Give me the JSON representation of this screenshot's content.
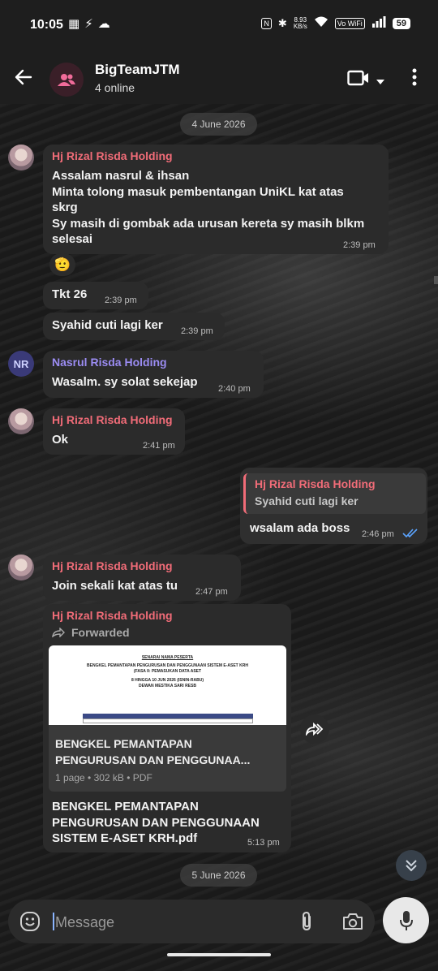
{
  "status_bar": {
    "time": "10:05",
    "net_speed": "8.93",
    "net_unit": "KB/s",
    "vowifi": "Vo WiFi",
    "battery": "59"
  },
  "header": {
    "title": "BigTeamJTM",
    "subtitle": "4 online"
  },
  "messages": {
    "date1": "4 June 2026",
    "m1_sender": "Hj Rizal Risda Holding",
    "m1_line1": "Assalam nasrul & ihsan",
    "m1_line2": "Minta tolong masuk pembentangan UniKL kat atas",
    "m1_line3": "skrg",
    "m1_line4": "Sy masih di gombak ada urusan kereta sy masih blkm",
    "m1_line5": "selesai",
    "m1_time": "2:39 pm",
    "reaction": "🫡",
    "m2_text": "Tkt 26",
    "m2_time": "2:39 pm",
    "m3_text": "Syahid cuti lagi ker",
    "m3_time": "2:39 pm",
    "m4_avatar": "NR",
    "m4_sender": "Nasrul Risda Holding",
    "m4_text": "Wasalm. sy solat sekejap",
    "m4_time": "2:40 pm",
    "m5_sender": "Hj Rizal Risda Holding",
    "m5_text": "Ok",
    "m5_time": "2:41 pm",
    "m6_reply_sender": "Hj Rizal Risda Holding",
    "m6_reply_text": "Syahid cuti lagi ker",
    "m6_text": "wsalam ada boss",
    "m6_time": "2:46 pm",
    "m7_sender": "Hj Rizal Risda Holding",
    "m7_text": "Join sekali kat atas tu",
    "m7_time": "2:47 pm",
    "m8_sender": "Hj Rizal Risda Holding",
    "m8_forwarded": "Forwarded",
    "doc_preview_heading": "SENARAI NAMA PESERTA",
    "doc_preview_line1": "BENGKEL PEMANTAPAN PENGURUSAN DAN PENGGUNAAN SISTEM E-ASET KRH",
    "doc_preview_line2": "(FASA II: PEMASUKAN DATA ASET",
    "doc_preview_line3": "8 HINGGA 10 JUN 2026 (ISNIN-RABU)",
    "doc_preview_line4": "DEWAN MESTIKA SARI RESB",
    "doc_title_1": "BENGKEL PEMANTAPAN",
    "doc_title_2": "PENGURUSAN DAN PENGGUNAA...",
    "doc_meta": "1 page • 302 kB • PDF",
    "m8_caption_1": "BENGKEL PEMANTAPAN",
    "m8_caption_2": "PENGURUSAN DAN PENGGUNAAN",
    "m8_caption_3": "SISTEM E-ASET KRH.pdf",
    "m8_time": "5:13 pm",
    "date2": "5 June 2026"
  },
  "input": {
    "placeholder": "Message"
  },
  "colors": {
    "sender_red": "#f16c78",
    "sender_purple": "#9b8cf2",
    "read_check": "#5ba4ff"
  }
}
